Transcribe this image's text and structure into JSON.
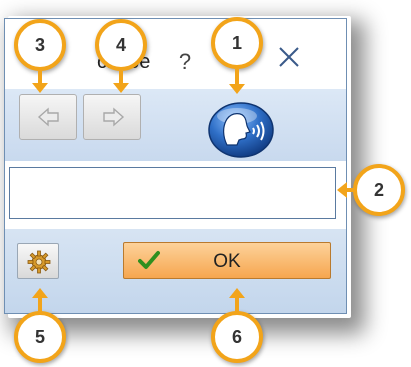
{
  "dialog": {
    "title": "cl    abe",
    "help_glyph": "?",
    "close_icon": "close-icon"
  },
  "toolbar": {
    "back_icon": "arrow-left-icon",
    "forward_icon": "arrow-right-icon",
    "speak_icon": "speaking-head-icon"
  },
  "text_field": {
    "value": ""
  },
  "bottom": {
    "settings_icon": "gear-icon",
    "ok_label": "OK",
    "ok_icon": "checkmark-icon"
  },
  "callouts": {
    "c1": "1",
    "c2": "2",
    "c3": "3",
    "c4": "4",
    "c5": "5",
    "c6": "6"
  },
  "colors": {
    "callout_ring": "#f2a41a",
    "ok_button": "#f6a64f",
    "toolbar_bg": "#dce8f6",
    "speak_button": "#2f6fc7"
  }
}
